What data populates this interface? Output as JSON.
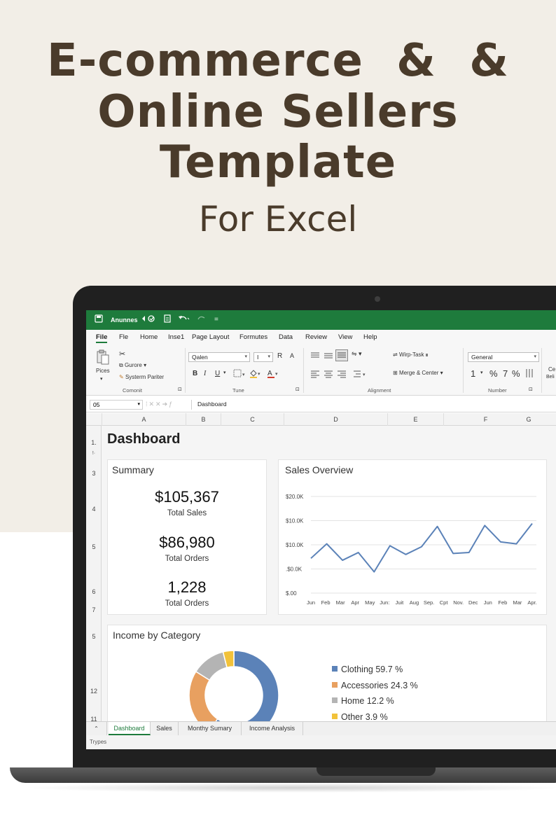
{
  "hero": {
    "line1": "E-commerce & ",
    "line1_amp": "&",
    "line2": "Online Sellers",
    "line3": "Template",
    "line4": "For Excel"
  },
  "titlebar": {
    "app_name": "Anunnes",
    "extra": "="
  },
  "menu": {
    "tabs": [
      "File",
      "Fle",
      "Home",
      "Inse1",
      "Page Layout",
      "Formutes",
      "Data",
      "Review",
      "View",
      "Help"
    ]
  },
  "ribbon": {
    "paste_label": "Pices",
    "cut_label": "Gurore",
    "format_painter_label": "Systerm Pariter",
    "clipboard_group": "Comonit",
    "font_name": "Qalen",
    "font_size": "I",
    "font_grow": "R",
    "font_shrink": "A",
    "bold": "B",
    "italic": "I",
    "underline": "U",
    "font_group": "Tune",
    "wrap_text": "Wirp-Task",
    "merge_center": "Merge & Center",
    "alignment_group": "Alignment",
    "number_format": "General",
    "number_one": "1",
    "percent": "%",
    "seven": "7",
    "percent2": "%",
    "number_group": "Number",
    "cut_partial": "Ce",
    "cut_partial2": "Beli"
  },
  "formula_bar": {
    "name_box": "05",
    "value": "Dashboard"
  },
  "columns": [
    "A",
    "B",
    "C",
    "D",
    "E",
    "F",
    "G"
  ],
  "rows": [
    "1.",
    "!·",
    "3",
    "4",
    "5",
    "6",
    "7",
    "5",
    "12",
    "11"
  ],
  "dashboard": {
    "title": "Dashboard",
    "summary": {
      "title": "Summary",
      "kpis": [
        {
          "value": "$105,367",
          "label": "Total Sales"
        },
        {
          "value": "$86,980",
          "label": "Total Orders"
        },
        {
          "value": "1,228",
          "label": "Total Orders"
        }
      ]
    },
    "income": {
      "title": "Income by Category"
    }
  },
  "chart_data": [
    {
      "type": "line",
      "title": "Sales Overview",
      "x": [
        "Jun",
        "Feb",
        "Mar",
        "Apr",
        "May",
        "Jun:",
        "Juit",
        "Aug",
        "Sep.",
        "Cpt",
        "Nov.",
        "Dec",
        "Jun",
        "Feb",
        "Mar",
        "Apr."
      ],
      "y_tick_labels": [
        "$20.0K",
        "$10.0K",
        "$10.0K",
        ".$0.0K",
        "$.00"
      ],
      "series": [
        {
          "values": [
            0.36,
            0.51,
            0.34,
            0.42,
            0.22,
            0.49,
            0.4,
            0.48,
            0.69,
            0.41,
            0.42,
            0.7,
            0.53,
            0.51,
            0.72
          ]
        }
      ],
      "ylim": [
        0,
        1
      ],
      "color": "#5b82b8",
      "grid": true
    },
    {
      "type": "pie",
      "title": "Income by Category",
      "categories": [
        "Clothing",
        "Accessories",
        "Home",
        "Other"
      ],
      "values": [
        59.7,
        24.3,
        12.2,
        3.9
      ],
      "labels": [
        "59.7 %",
        "24.3 %",
        "12.2 %",
        "3.9 %"
      ],
      "colors": [
        "#5b82b8",
        "#e8a060",
        "#b4b4b4",
        "#f2c23a"
      ],
      "legend": "right"
    }
  ],
  "sheet_tabs": [
    "Dashboard",
    "Sales",
    "Monthy Sumary",
    "Income Analysis"
  ],
  "status": {
    "left": "Trypes"
  },
  "colors": {
    "excel_green": "#1e7b3c",
    "hero_text": "#4a3b2b",
    "hero_bg": "#f2eee7"
  }
}
